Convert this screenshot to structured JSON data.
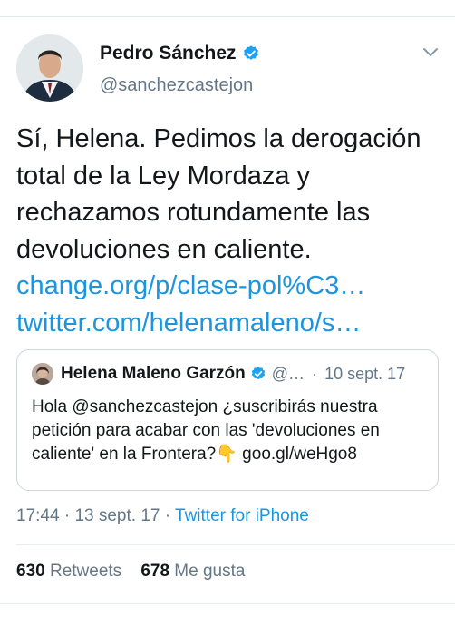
{
  "author": {
    "name": "Pedro Sánchez",
    "handle": "@sanchezcastejon",
    "verified_icon": "verified-badge-icon"
  },
  "tweet": {
    "text": "Sí, Helena. Pedimos la derogación total de la Ley Mordaza y rechazamos rotundamente las devoluciones en caliente.",
    "link1": "change.org/p/clase-pol%C3…",
    "link2": "twitter.com/helenamaleno/s…"
  },
  "quoted": {
    "name": "Helena Maleno Garzón",
    "handle": "@…",
    "separator": "·",
    "date": "10 sept. 17",
    "text": "Hola @sanchezcastejon  ¿suscribirás nuestra petición para acabar con las 'devoluciones en caliente' en la Frontera?👇 goo.gl/weHgo8"
  },
  "meta": {
    "time": "17:44",
    "sep1": "·",
    "date": "13 sept. 17",
    "sep2": "·",
    "source": "Twitter for iPhone"
  },
  "stats": {
    "retweets_count": "630",
    "retweets_label": "Retweets",
    "likes_count": "678",
    "likes_label": "Me gusta"
  },
  "colors": {
    "link": "#1b95e0",
    "secondary_text": "#657786",
    "border": "#ccd6dd"
  }
}
